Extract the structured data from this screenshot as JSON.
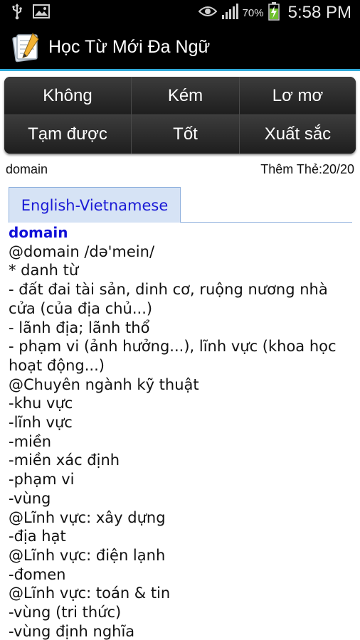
{
  "status_bar": {
    "icons": [
      "usb-icon",
      "image-icon",
      "eye-icon",
      "signal-icon",
      "battery-charging-icon"
    ],
    "battery": "70%",
    "time": "5:58 PM"
  },
  "app": {
    "title": "Học Từ Mới Đa Ngữ",
    "icon": "notepad-icon"
  },
  "rating_buttons": [
    {
      "label": "Không"
    },
    {
      "label": "Kém"
    },
    {
      "label": "Lơ mơ"
    },
    {
      "label": "Tạm được"
    },
    {
      "label": "Tốt"
    },
    {
      "label": "Xuất sắc"
    }
  ],
  "info": {
    "word": "domain",
    "counter": "Thêm Thẻ:20/20"
  },
  "dictionary": {
    "tab_label": "English-Vietnamese",
    "headword": "domain",
    "lines": [
      "@domain /də'mein/",
      "* danh từ",
      "- đất đai tài sản, dinh cơ, ruộng nương nhà cửa (của địa chủ...)",
      "- lãnh địa; lãnh thổ",
      "- phạm vi (ảnh hưởng...), lĩnh vực (khoa học hoạt động...)",
      "@Chuyên ngành kỹ thuật",
      "-khu vực",
      "-lĩnh vực",
      "-miền",
      "-miền xác định",
      "-phạm vi",
      "-vùng",
      "@Lĩnh vực: xây dựng",
      "-địa hạt",
      "@Lĩnh vực: điện lạnh",
      "-đomen",
      "@Lĩnh vực: toán & tin",
      "-vùng (tri thức)",
      "-vùng định nghĩa"
    ]
  },
  "colors": {
    "accent_line": "#2fa9d9",
    "headword": "#1010d8",
    "tab_background": "#d6e3f5"
  }
}
